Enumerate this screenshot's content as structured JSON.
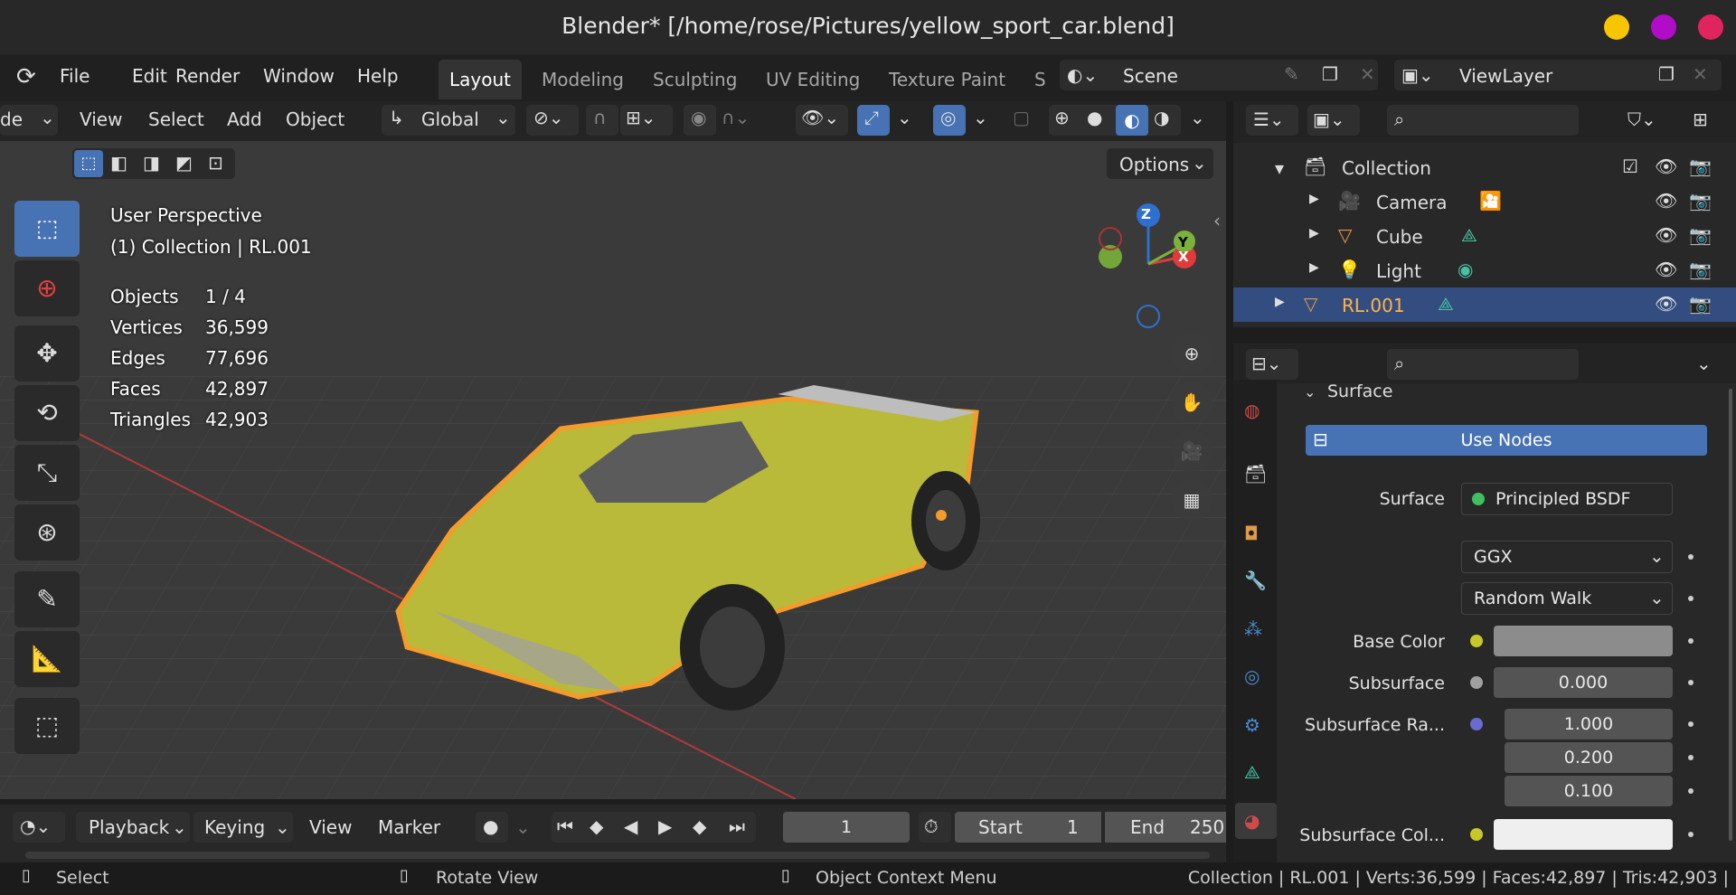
{
  "window": {
    "title": "Blender* [/home/rose/Pictures/yellow_sport_car.blend]",
    "dots": [
      "#f7c600",
      "#b10dc9",
      "#e0245e"
    ]
  },
  "menu": [
    "File",
    "Edit",
    "Render",
    "Window",
    "Help"
  ],
  "workspaces": [
    "Layout",
    "Modeling",
    "Sculpting",
    "UV Editing",
    "Texture Paint",
    "S"
  ],
  "scene": "Scene",
  "view_layer": "ViewLayer",
  "viewport_header": {
    "mode": "de",
    "menus": [
      "View",
      "Select",
      "Add",
      "Object"
    ],
    "orientation": "Global",
    "options": "Options"
  },
  "overlay": {
    "perspective": "User Perspective",
    "collection": "(1) Collection | RL.001",
    "stats": [
      {
        "k": "Objects",
        "v": "1 / 4"
      },
      {
        "k": "Vertices",
        "v": "36,599"
      },
      {
        "k": "Edges",
        "v": "77,696"
      },
      {
        "k": "Faces",
        "v": "42,897"
      },
      {
        "k": "Triangles",
        "v": "42,903"
      }
    ]
  },
  "gizmo": {
    "z": "Z",
    "y": "Y",
    "x": "X"
  },
  "outliner": {
    "items": [
      "Collection",
      "Camera",
      "Cube",
      "Light",
      "RL.001"
    ]
  },
  "properties": {
    "section": "Surface",
    "use_nodes": "Use Nodes",
    "surface_label": "Surface",
    "surface_value": "Principled BSDF",
    "distribution": "GGX",
    "subsurface_method": "Random Walk",
    "base_color_label": "Base Color",
    "subsurface_label": "Subsurface",
    "subsurface_value": "0.000",
    "ss_radius_label": "Subsurface Ra...",
    "ss_radius": [
      "1.000",
      "0.200",
      "0.100"
    ],
    "ss_color_label": "Subsurface Col..."
  },
  "timeline": {
    "playback": "Playback",
    "keying": "Keying",
    "view": "View",
    "marker": "Marker",
    "frame": "1",
    "start_label": "Start",
    "start": "1",
    "end_label": "End",
    "end": "250"
  },
  "status": {
    "select": "Select",
    "rotate": "Rotate View",
    "context": "Object Context Menu",
    "info": "Collection | RL.001 | Verts:36,599 | Faces:42,897 | Tris:42,903 |"
  }
}
